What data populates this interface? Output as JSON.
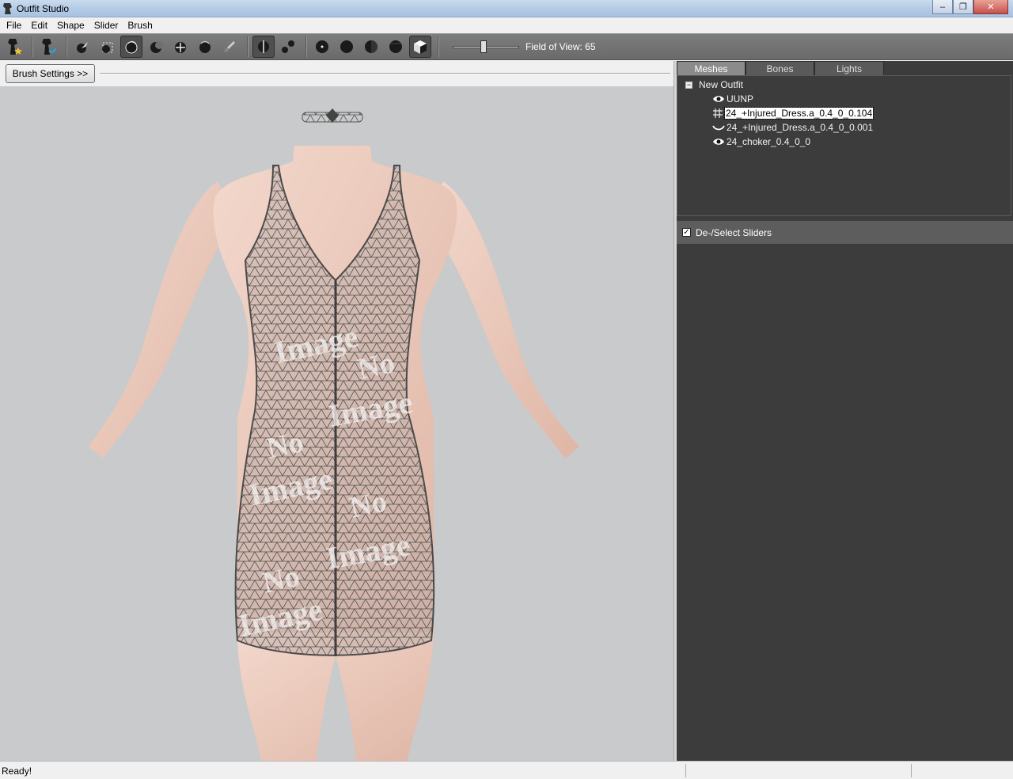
{
  "window": {
    "title": "Outfit Studio"
  },
  "menu": [
    "File",
    "Edit",
    "Shape",
    "Slider",
    "Brush"
  ],
  "toolbar": {
    "fov_label": "Field of View: 65",
    "fov_value": 65
  },
  "left": {
    "brush_settings_label": "Brush Settings >>"
  },
  "right": {
    "tabs": [
      "Meshes",
      "Bones",
      "Lights"
    ],
    "tree": {
      "root": "New Outfit",
      "items": [
        {
          "label": "UUNP",
          "icon": "eye-icon"
        },
        {
          "label": "24_+Injured_Dress.a_0.4_0_0.104",
          "icon": "grid-icon",
          "selected": true
        },
        {
          "label": "24_+Injured_Dress.a_0.4_0_0.001",
          "icon": "closed-eye-icon"
        },
        {
          "label": "24_choker_0.4_0_0",
          "icon": "eye-icon"
        }
      ]
    },
    "sliders_header": "De-/Select Sliders",
    "sliders_checked": true
  },
  "viewport": {
    "watermark_word1": "No",
    "watermark_word2": "Image"
  },
  "status": {
    "text": "Ready!"
  }
}
